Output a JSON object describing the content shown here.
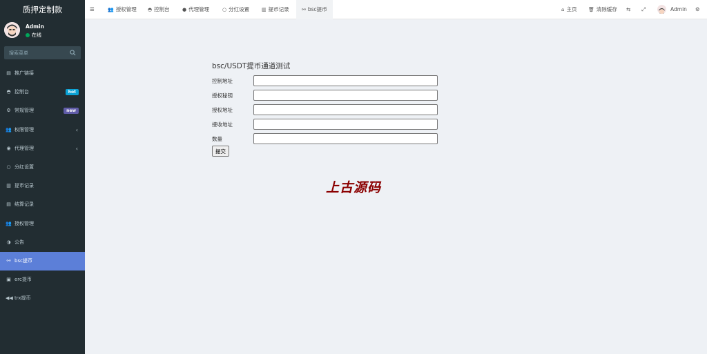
{
  "brand": "质押定制款",
  "user": {
    "name": "Admin",
    "status": "在线"
  },
  "search": {
    "placeholder": "搜索菜单"
  },
  "sidebar": {
    "items": [
      {
        "label": "推广链接",
        "icon": "list-icon"
      },
      {
        "label": "控制台",
        "icon": "dashboard-icon",
        "badge": "hot"
      },
      {
        "label": "常规管理",
        "icon": "cogs-icon",
        "badge": "new"
      },
      {
        "label": "权限管理",
        "icon": "users-icon",
        "caret": "‹"
      },
      {
        "label": "代理管理",
        "icon": "user-circle-icon",
        "caret": "‹"
      },
      {
        "label": "分红设置",
        "icon": "circle-icon"
      },
      {
        "label": "提币记录",
        "icon": "bank-icon"
      },
      {
        "label": "结算记录",
        "icon": "list-icon"
      },
      {
        "label": "授权管理",
        "icon": "users-icon"
      },
      {
        "label": "公告",
        "icon": "adjust-icon"
      },
      {
        "label": "bsc提币",
        "icon": "motorcycle-icon",
        "active": true
      },
      {
        "label": "erc提币",
        "icon": "briefcase-icon"
      },
      {
        "label": "trx提币",
        "icon": "backward-icon"
      }
    ]
  },
  "topbar": {
    "tabs": [
      {
        "label": "授权管理",
        "icon": "users-icon"
      },
      {
        "label": "控制台",
        "icon": "dashboard-icon"
      },
      {
        "label": "代理管理",
        "icon": "user-icon"
      },
      {
        "label": "分红设置",
        "icon": "circle-icon"
      },
      {
        "label": "提币记录",
        "icon": "bank-icon"
      },
      {
        "label": "bsc提币",
        "icon": "motorcycle-icon",
        "active": true
      }
    ],
    "home": "主页",
    "clear_cache": "清除缓存",
    "user": "Admin"
  },
  "form": {
    "title": "bsc/USDT提币通道测试",
    "fields": [
      {
        "label": "控制地址",
        "value": ""
      },
      {
        "label": "授权秘钥",
        "value": ""
      },
      {
        "label": "授权地址",
        "value": ""
      },
      {
        "label": "接收地址",
        "value": ""
      },
      {
        "label": "数量",
        "value": ""
      }
    ],
    "submit": "提交"
  },
  "watermark": "上古源码",
  "colors": {
    "sidebar": "#222d32",
    "active": "#5c7fd8",
    "hot": "#0ba2d5",
    "new": "#605ca8",
    "watermark": "#8b0000"
  }
}
